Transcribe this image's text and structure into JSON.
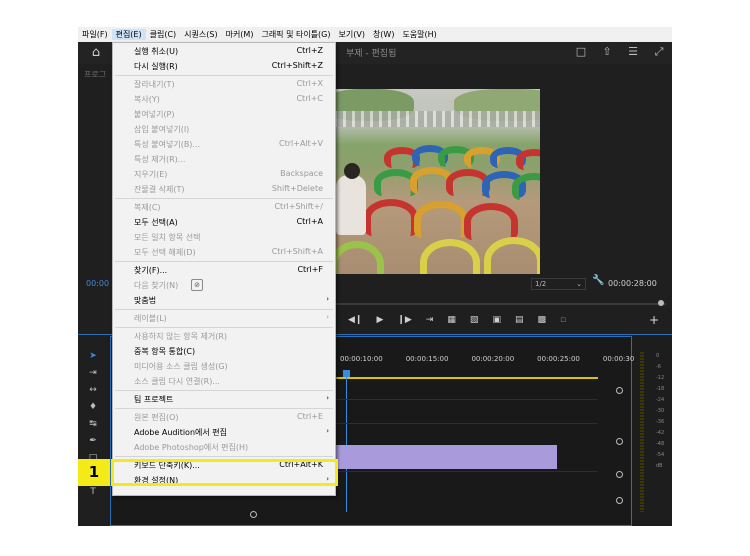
{
  "menubar": [
    {
      "label": "파일(F)"
    },
    {
      "label": "편집(E)",
      "active": true
    },
    {
      "label": "클립(C)"
    },
    {
      "label": "시퀀스(S)"
    },
    {
      "label": "마커(M)"
    },
    {
      "label": "그래픽 및 타이틀(G)"
    },
    {
      "label": "보기(V)"
    },
    {
      "label": "창(W)"
    },
    {
      "label": "도움말(H)"
    }
  ],
  "workspace": {
    "title": "부제 - 편집됨",
    "left_label": "프로그"
  },
  "program": {
    "zoom": "1/2",
    "timecode": "00:00:28:00"
  },
  "source": {
    "timecode": "00:00"
  },
  "timeline": {
    "ruler": [
      "00:00:10:00",
      "00:00:15:00",
      "00:00:20:00",
      "00:00:25:00",
      "00:00:30:00"
    ]
  },
  "meter": {
    "labels": [
      "0",
      "-6",
      "-12",
      "-18",
      "-24",
      "-30",
      "-36",
      "-42",
      "-48",
      "-54",
      "dB"
    ]
  },
  "menu": {
    "items": [
      {
        "label": "실행 취소(U)",
        "shortcut": "Ctrl+Z",
        "enabled": true
      },
      {
        "label": "다시 실행(R)",
        "shortcut": "Ctrl+Shift+Z",
        "enabled": true
      },
      {
        "sep": true
      },
      {
        "label": "잘라내기(T)",
        "shortcut": "Ctrl+X",
        "enabled": false
      },
      {
        "label": "복사(Y)",
        "shortcut": "Ctrl+C",
        "enabled": false
      },
      {
        "label": "붙여넣기(P)",
        "shortcut": "",
        "enabled": false
      },
      {
        "label": "삽입 붙여넣기(I)",
        "shortcut": "",
        "enabled": false
      },
      {
        "label": "특성 붙여넣기(B)...",
        "shortcut": "Ctrl+Alt+V",
        "enabled": false
      },
      {
        "label": "특성 제거(R)...",
        "shortcut": "",
        "enabled": false
      },
      {
        "label": "지우기(E)",
        "shortcut": "Backspace",
        "enabled": false
      },
      {
        "label": "잔물결 삭제(T)",
        "shortcut": "Shift+Delete",
        "enabled": false
      },
      {
        "sep": true
      },
      {
        "label": "복제(C)",
        "shortcut": "Ctrl+Shift+/",
        "enabled": false
      },
      {
        "label": "모두 선택(A)",
        "shortcut": "Ctrl+A",
        "enabled": true
      },
      {
        "label": "모든 일치 항목 선택",
        "shortcut": "",
        "enabled": false
      },
      {
        "label": "모두 선택 해제(D)",
        "shortcut": "Ctrl+Shift+A",
        "enabled": false
      },
      {
        "sep": true
      },
      {
        "label": "찾기(F)...",
        "shortcut": "Ctrl+F",
        "enabled": true
      },
      {
        "label": "다음 찾기(N)",
        "shortcut": "",
        "enabled": false,
        "icon": true
      },
      {
        "label": "맞춤법",
        "shortcut": "",
        "enabled": true,
        "submenu": true
      },
      {
        "sep": true
      },
      {
        "label": "레이블(L)",
        "shortcut": "",
        "enabled": false,
        "submenu": true
      },
      {
        "sep": true
      },
      {
        "label": "사용하지 않는 항목 제거(R)",
        "shortcut": "",
        "enabled": false
      },
      {
        "label": "중복 항목 통합(C)",
        "shortcut": "",
        "enabled": true
      },
      {
        "label": "미디어용 소스 클립 생성(G)",
        "shortcut": "",
        "enabled": false
      },
      {
        "label": "소스 클립 다시 연결(R)...",
        "shortcut": "",
        "enabled": false
      },
      {
        "sep": true
      },
      {
        "label": "팀 프로젝트",
        "shortcut": "",
        "enabled": true,
        "submenu": true
      },
      {
        "sep": true
      },
      {
        "label": "원본 편집(O)",
        "shortcut": "Ctrl+E",
        "enabled": false
      },
      {
        "label": "Adobe Audition에서 편집",
        "shortcut": "",
        "enabled": true,
        "submenu": true
      },
      {
        "label": "Adobe Photoshop에서 편집(H)",
        "shortcut": "",
        "enabled": false
      },
      {
        "sep": true
      },
      {
        "label": "키보드 단축키(K)...",
        "shortcut": "Ctrl+Alt+K",
        "enabled": true
      },
      {
        "label": "환경 설정(N)",
        "shortcut": "",
        "enabled": true,
        "submenu": true
      }
    ]
  },
  "callout": {
    "number": "1"
  }
}
